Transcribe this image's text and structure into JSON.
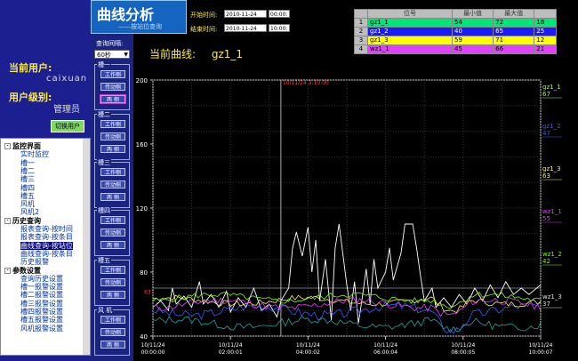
{
  "left": {
    "current_user_label": "当前用户:",
    "current_user": "caixuan",
    "user_level_label": "用户级别:",
    "user_level": "管理员",
    "switch_user": "切换用户"
  },
  "tree": [
    {
      "label": "监控界面",
      "group": true,
      "box": "-"
    },
    {
      "label": "实时监控"
    },
    {
      "label": "槽一"
    },
    {
      "label": "槽二"
    },
    {
      "label": "槽三"
    },
    {
      "label": "槽四"
    },
    {
      "label": "槽五"
    },
    {
      "label": "风机"
    },
    {
      "label": "风机2"
    },
    {
      "label": "历史查询",
      "group": true,
      "box": "-"
    },
    {
      "label": "报表查询-按时间"
    },
    {
      "label": "报表查询-按条目"
    },
    {
      "label": "曲线查询-按站位",
      "selected": true
    },
    {
      "label": "曲线查询-按条目"
    },
    {
      "label": "历史报警"
    },
    {
      "label": "参数设置",
      "group": true,
      "box": "-"
    },
    {
      "label": "查询历史设置"
    },
    {
      "label": "槽一报警设置"
    },
    {
      "label": "槽二报警设置"
    },
    {
      "label": "槽三报警设置"
    },
    {
      "label": "槽四报警设置"
    },
    {
      "label": "槽五报警设置"
    },
    {
      "label": "风机报警设置"
    }
  ],
  "header": {
    "title": "曲线分析",
    "subtitle": "——按站位查询",
    "start_label": "开始时间:",
    "start_date": "2010-11-24",
    "start_time": "00:00:",
    "end_label": "结束时间:",
    "end_date": "2010-11-24",
    "end_time": "10:00:",
    "interval_label": "查询间隔:",
    "interval_value": "60秒",
    "current_curve_label": "当前曲线:",
    "current_curve_value": "gz1_1"
  },
  "groups": [
    {
      "title": "槽一",
      "buttons": [
        "工作侧",
        "传动侧",
        "两 侧"
      ]
    },
    {
      "title": "槽二",
      "buttons": [
        "工作侧",
        "传动侧",
        "两 侧"
      ]
    },
    {
      "title": "槽三",
      "buttons": [
        "工作侧",
        "传动侧",
        "两 侧"
      ]
    },
    {
      "title": "槽四",
      "buttons": [
        "工作侧",
        "传动侧",
        "两 侧"
      ]
    },
    {
      "title": "槽五",
      "buttons": [
        "工作侧",
        "传动侧",
        "两 侧"
      ]
    },
    {
      "title": "风 机",
      "buttons": [
        "工作侧",
        "传动侧",
        "两 侧"
      ]
    }
  ],
  "table": {
    "headers": [
      "位号",
      "最小值",
      "最大值"
    ],
    "rows": [
      {
        "n": "1",
        "name": "gz1_1",
        "min": "54",
        "max": "72",
        "val": "18",
        "bg": "#00e676",
        "fg": "#000"
      },
      {
        "n": "2",
        "name": "gz1_2",
        "min": "40",
        "max": "65",
        "val": "25",
        "bg": "#1a1aff",
        "fg": "#fff"
      },
      {
        "n": "3",
        "name": "gz1_3",
        "min": "59",
        "max": "71",
        "val": "12",
        "bg": "#ffff00",
        "fg": "#000"
      },
      {
        "n": "4",
        "name": "wz1_1",
        "min": "45",
        "max": "66",
        "val": "21",
        "bg": "#e040fb",
        "fg": "#000"
      }
    ]
  },
  "chart_data": {
    "type": "line",
    "ylim": [
      40,
      200
    ],
    "yticks": [
      "200",
      "160",
      "120",
      "80",
      "40"
    ],
    "xticks": [
      {
        "d": "10/11/24",
        "t": "00:00:00"
      },
      {
        "d": "10/11/24",
        "t": "02:00:01"
      },
      {
        "d": "10/11/24",
        "t": "04:00:02"
      },
      {
        "d": "10/11/24",
        "t": "06:00:04"
      },
      {
        "d": "10/11/24",
        "t": "08:00:05"
      },
      {
        "d": "10/11/24",
        "t": "10:00:07"
      }
    ],
    "cursor_label": "10/11/24 3:10:00",
    "cursor_marker": "63",
    "series": [
      {
        "name": "gz1_1",
        "value": "67",
        "color": "#ffffff",
        "label_color": "#9cff57"
      },
      {
        "name": "gz1_2",
        "value": "47",
        "color": "#3d5afe",
        "label_color": "#3d5afe"
      },
      {
        "name": "gz1_3",
        "value": "63",
        "color": "#ffee58",
        "label_color": "#ffee58"
      },
      {
        "name": "wz1_1",
        "value": "55",
        "color": "#e040fb",
        "label_color": "#e040fb"
      },
      {
        "name": "wz1_2",
        "value": "42",
        "color": "#76ff03",
        "label_color": "#76ff03"
      },
      {
        "name": "wz1_3",
        "value": "37",
        "color": "#26a69a",
        "label_color": "#dddddd"
      }
    ],
    "white_levels": [
      [
        0,
        58
      ],
      [
        0.02,
        62
      ],
      [
        0.04,
        56
      ],
      [
        0.05,
        70
      ],
      [
        0.06,
        60
      ],
      [
        0.08,
        65
      ],
      [
        0.1,
        58
      ],
      [
        0.12,
        74
      ],
      [
        0.13,
        60
      ],
      [
        0.15,
        66
      ],
      [
        0.17,
        58
      ],
      [
        0.19,
        68
      ],
      [
        0.2,
        55
      ],
      [
        0.22,
        64
      ],
      [
        0.24,
        58
      ],
      [
        0.26,
        70
      ],
      [
        0.28,
        56
      ],
      [
        0.3,
        60
      ],
      [
        0.32,
        52
      ],
      [
        0.33,
        62
      ],
      [
        0.35,
        70
      ],
      [
        0.36,
        95
      ],
      [
        0.37,
        105
      ],
      [
        0.385,
        90
      ],
      [
        0.4,
        108
      ],
      [
        0.41,
        80
      ],
      [
        0.42,
        100
      ],
      [
        0.43,
        62
      ],
      [
        0.445,
        88
      ],
      [
        0.46,
        50
      ],
      [
        0.47,
        95
      ],
      [
        0.48,
        110
      ],
      [
        0.5,
        72
      ],
      [
        0.51,
        56
      ],
      [
        0.52,
        74
      ],
      [
        0.53,
        48
      ],
      [
        0.54,
        64
      ],
      [
        0.55,
        82
      ],
      [
        0.56,
        60
      ],
      [
        0.57,
        88
      ],
      [
        0.58,
        70
      ],
      [
        0.6,
        80
      ],
      [
        0.61,
        95
      ],
      [
        0.62,
        75
      ],
      [
        0.64,
        92
      ],
      [
        0.65,
        110
      ],
      [
        0.67,
        110
      ],
      [
        0.68,
        95
      ],
      [
        0.69,
        78
      ],
      [
        0.7,
        62
      ],
      [
        0.72,
        70
      ],
      [
        0.73,
        58
      ],
      [
        0.75,
        64
      ],
      [
        0.77,
        58
      ],
      [
        0.79,
        66
      ],
      [
        0.81,
        60
      ],
      [
        0.83,
        70
      ],
      [
        0.85,
        62
      ],
      [
        0.87,
        72
      ],
      [
        0.89,
        64
      ],
      [
        0.91,
        74
      ],
      [
        0.93,
        66
      ],
      [
        0.95,
        70
      ],
      [
        0.97,
        66
      ],
      [
        1.0,
        72
      ]
    ]
  }
}
